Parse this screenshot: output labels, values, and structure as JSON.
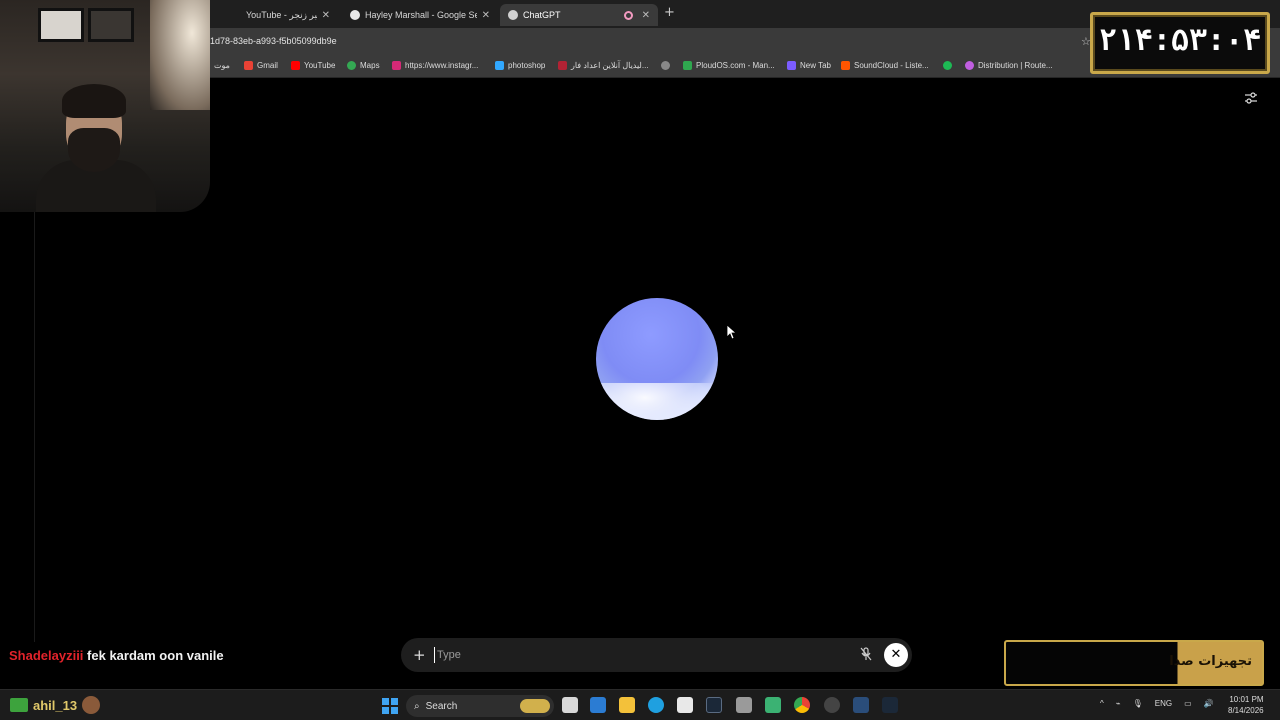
{
  "browser": {
    "tabs": [
      {
        "label": "YouTube - خبر زنجر",
        "active": false
      },
      {
        "label": "Hayley Marshall - Google Search",
        "active": false
      },
      {
        "label": "ChatGPT",
        "active": true
      }
    ],
    "url": "1d78-83eb-a993-f5b05099db9e",
    "bookmarks": [
      {
        "label": "موت",
        "icon": "bookmark-icon"
      },
      {
        "label": "Gmail",
        "icon": "gmail-icon"
      },
      {
        "label": "YouTube",
        "icon": "youtube-icon"
      },
      {
        "label": "Maps",
        "icon": "maps-icon"
      },
      {
        "label": "https://www.instagr...",
        "icon": "instagram-icon"
      },
      {
        "label": "photoshop",
        "icon": "photoshop-icon"
      },
      {
        "label": "لیدیال آنلاین اعداد فار...",
        "icon": "flag-icon"
      },
      {
        "label": "PloudOS.com - Man...",
        "icon": "ploudos-icon"
      },
      {
        "label": "New Tab",
        "icon": "newtab-icon"
      },
      {
        "label": "SoundCloud - Liste...",
        "icon": "soundcloud-icon"
      },
      {
        "label": "Distribution | Route...",
        "icon": "distribution-icon"
      }
    ]
  },
  "voice": {
    "input_placeholder": "Type",
    "orb_colors": [
      "#7f8cf5",
      "#f4f6ff"
    ]
  },
  "overlay": {
    "clock": "۲۱۴:۵۳:۰۴",
    "sponsor": "تجهیزات صدا",
    "chat": {
      "user": "Shadelayziii",
      "message": "fek kardam oon vanile"
    },
    "taskbar_user": "ahil_13"
  },
  "taskbar": {
    "search_label": "Search",
    "lang": "ENG",
    "time": "10:01 PM",
    "date": "8/14/2026"
  },
  "colors": {
    "accent_gold": "#c9a84a",
    "chat_user": "#e2232b"
  }
}
